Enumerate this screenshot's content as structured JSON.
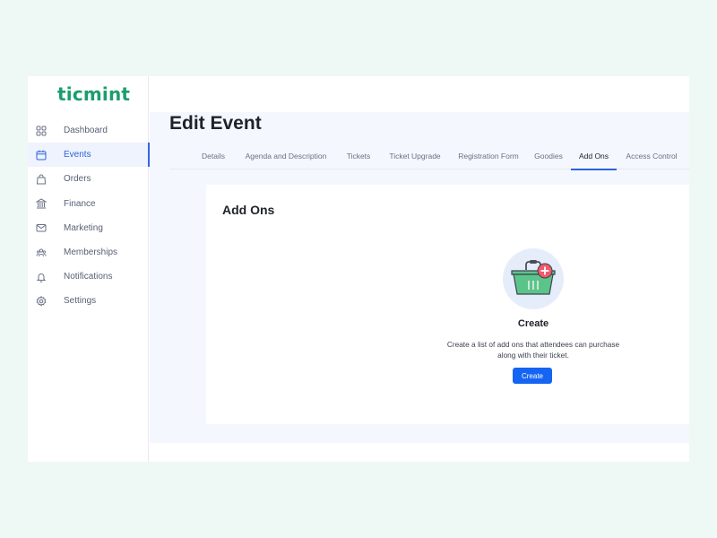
{
  "brand": {
    "logo": "ticmint",
    "accent": "#1a9e6e",
    "primary": "#1565f2"
  },
  "sidebar": {
    "items": [
      {
        "label": "Dashboard",
        "icon": "grid-icon",
        "active": false
      },
      {
        "label": "Events",
        "icon": "calendar-icon",
        "active": true
      },
      {
        "label": "Orders",
        "icon": "shopping-bag-icon",
        "active": false
      },
      {
        "label": "Finance",
        "icon": "bank-icon",
        "active": false
      },
      {
        "label": "Marketing",
        "icon": "mail-icon",
        "active": false
      },
      {
        "label": "Memberships",
        "icon": "users-icon",
        "active": false
      },
      {
        "label": "Notifications",
        "icon": "bell-icon",
        "active": false
      },
      {
        "label": "Settings",
        "icon": "gear-icon",
        "active": false
      }
    ]
  },
  "main": {
    "title": "Edit Event",
    "tabs": [
      {
        "label": "Details",
        "active": false
      },
      {
        "label": "Agenda and Description",
        "active": false
      },
      {
        "label": "Tickets",
        "active": false
      },
      {
        "label": "Ticket Upgrade",
        "active": false
      },
      {
        "label": "Registration Form",
        "active": false
      },
      {
        "label": "Goodies",
        "active": false
      },
      {
        "label": "Add Ons",
        "active": true
      },
      {
        "label": "Access Control",
        "active": false
      }
    ],
    "card": {
      "title": "Add Ons",
      "empty_state": {
        "illustration": "basket-add-icon",
        "title": "Create",
        "description": "Create a list of add ons that attendees can purchase along with their ticket.",
        "button_label": "Create"
      }
    }
  }
}
